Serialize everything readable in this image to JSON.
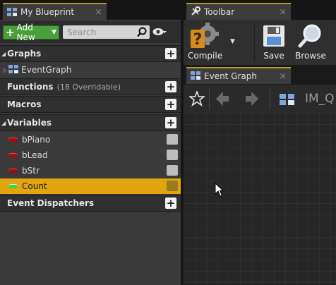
{
  "blueprint_tab": {
    "title": "My Blueprint",
    "close": "×"
  },
  "toolbar_tab": {
    "title": "Toolbar",
    "close": "×"
  },
  "left": {
    "add_new_label": "Add New",
    "search_placeholder": "Search",
    "sections": {
      "graphs": "Graphs",
      "functions": "Functions",
      "functions_sub": "(18 Overridable)",
      "macros": "Macros",
      "variables": "Variables",
      "event_dispatchers": "Event Dispatchers"
    },
    "graph_items": [
      {
        "label": "EventGraph"
      }
    ],
    "variables": [
      {
        "name": "bPiano",
        "type_color": "#a10d0d",
        "selected": false
      },
      {
        "name": "bLead",
        "type_color": "#a10d0d",
        "selected": false
      },
      {
        "name": "bStr",
        "type_color": "#a10d0d",
        "selected": false
      },
      {
        "name": "Count",
        "type_color": "#3fd63f",
        "selected": true
      }
    ]
  },
  "toolbar": {
    "compile_label": "Compile",
    "save_label": "Save",
    "browse_label": "Browse"
  },
  "event_graph_tab": {
    "title": "Event Graph",
    "close": "×"
  },
  "breadcrumb": {
    "text": "IM_Q"
  },
  "colors": {
    "accent": "#e1a510",
    "add_green": "#4b9f3a",
    "tab_accent": "#b59a2b"
  }
}
